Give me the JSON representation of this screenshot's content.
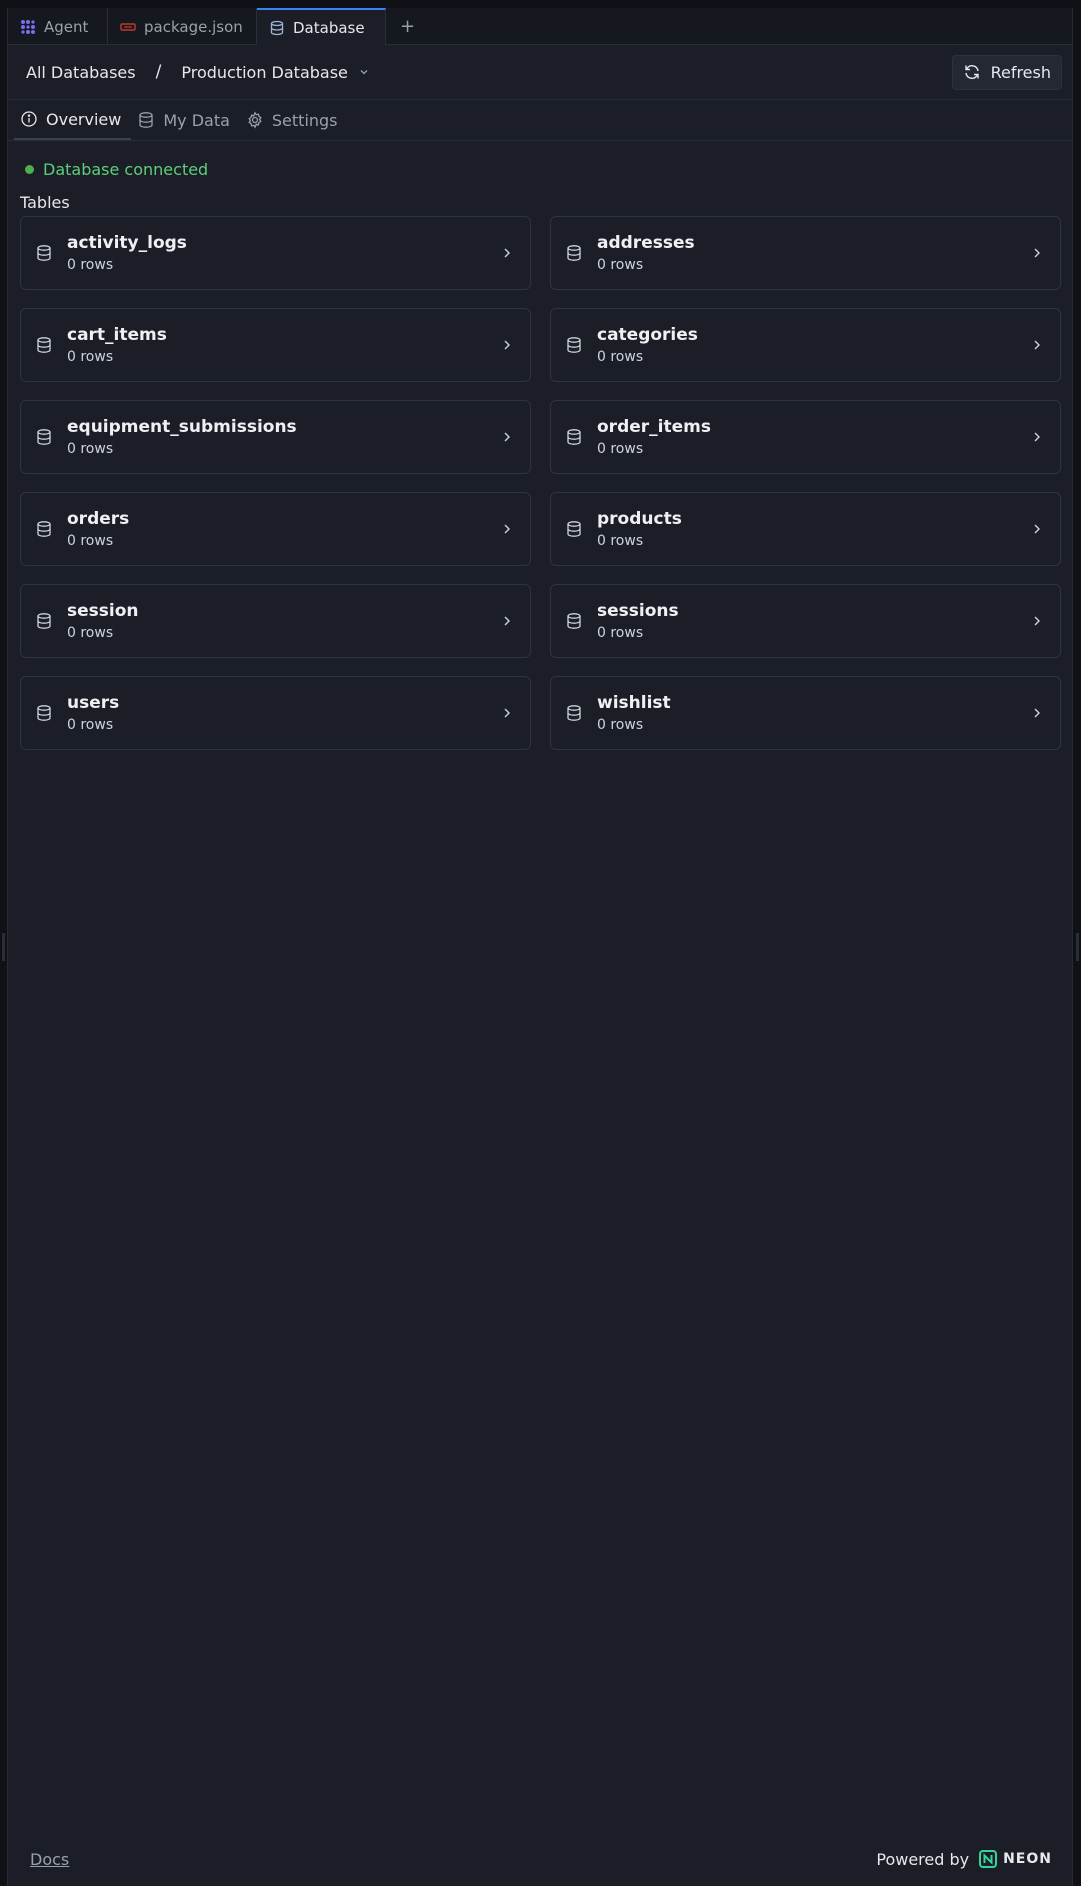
{
  "tabs": [
    {
      "label": "Agent",
      "icon": "agent-icon"
    },
    {
      "label": "package.json",
      "icon": "json-file-icon"
    },
    {
      "label": "Database",
      "icon": "database-icon",
      "active": true
    }
  ],
  "breadcrumb": {
    "root": "All Databases",
    "separator": "/",
    "current": "Production Database"
  },
  "toolbar": {
    "refresh_label": "Refresh"
  },
  "subtabs": [
    {
      "label": "Overview",
      "icon": "info-icon",
      "active": true
    },
    {
      "label": "My Data",
      "icon": "database-icon"
    },
    {
      "label": "Settings",
      "icon": "gear-icon"
    }
  ],
  "status": {
    "text": "Database connected",
    "color": "#4caf50"
  },
  "tables_section": {
    "label": "Tables",
    "items": [
      {
        "name": "activity_logs",
        "rows": "0 rows"
      },
      {
        "name": "addresses",
        "rows": "0 rows"
      },
      {
        "name": "cart_items",
        "rows": "0 rows"
      },
      {
        "name": "categories",
        "rows": "0 rows"
      },
      {
        "name": "equipment_submissions",
        "rows": "0 rows"
      },
      {
        "name": "order_items",
        "rows": "0 rows"
      },
      {
        "name": "orders",
        "rows": "0 rows"
      },
      {
        "name": "products",
        "rows": "0 rows"
      },
      {
        "name": "session",
        "rows": "0 rows"
      },
      {
        "name": "sessions",
        "rows": "0 rows"
      },
      {
        "name": "users",
        "rows": "0 rows"
      },
      {
        "name": "wishlist",
        "rows": "0 rows"
      }
    ]
  },
  "footer": {
    "docs_label": "Docs",
    "powered_by": "Powered by",
    "brand": "NEON"
  },
  "colors": {
    "accent": "#3b82f6",
    "brand_neon": "#34d59a"
  }
}
